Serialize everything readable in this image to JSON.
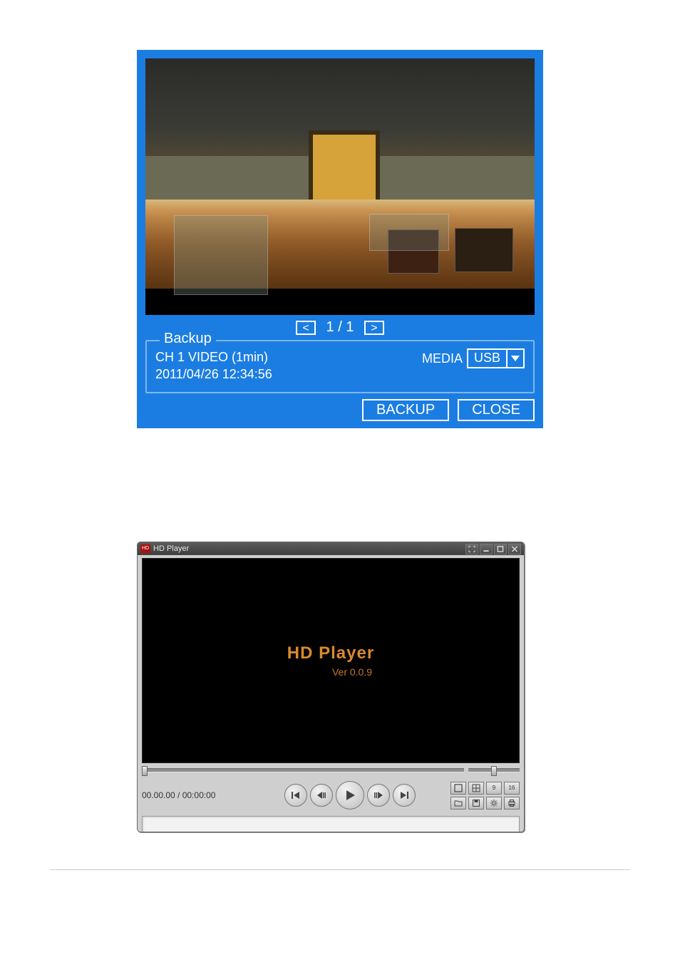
{
  "backup_dialog": {
    "pager": {
      "prev_symbol": "<",
      "text": "1 / 1",
      "next_symbol": ">"
    },
    "legend": "Backup",
    "channel_line": "CH 1 VIDEO (1min)",
    "timestamp_line": "2011/04/26  12:34:56",
    "media_label": "MEDIA",
    "media_value": "USB",
    "backup_btn": "BACKUP",
    "close_btn": "CLOSE"
  },
  "hdplayer": {
    "titlebar": {
      "logo_text": "HD",
      "title": "HD Player"
    },
    "splash": {
      "title": "HD Player",
      "version": "Ver 0.0.9"
    },
    "time_readout": "00.00.00 / 00:00:00",
    "grid_labels": {
      "nine": "9",
      "sixteen": "16"
    },
    "status_text": ""
  }
}
